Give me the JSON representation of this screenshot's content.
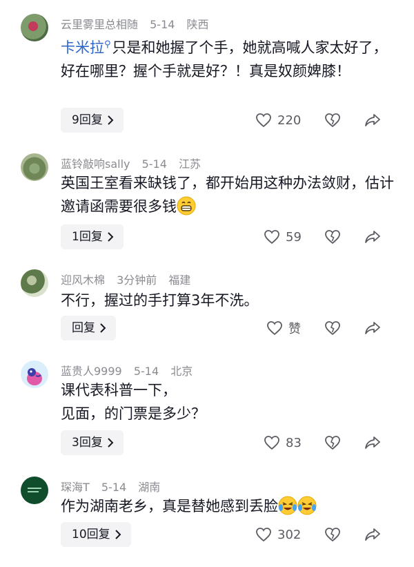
{
  "comments": [
    {
      "username": "云里雾里总相随",
      "date": "5-14",
      "location": "陕西",
      "mention": "卡米拉",
      "text": "只是和她握了个手，她就高喊人家太好了，好在哪里？握个手就是好？！真是奴颜婢膝！",
      "reply_label": "9回复",
      "likes": "220"
    },
    {
      "username": "蓝铃敲响sally",
      "date": "5-14",
      "location": "江苏",
      "text": "英国王室看来缺钱了，都开始用这种办法敛财，估计邀请函需要很多钱",
      "reply_label": "1回复",
      "likes": "59"
    },
    {
      "username": "迎风木棉",
      "date": "3分钟前",
      "location": "福建",
      "text": "不行，握过的手打算3年不洗。",
      "reply_label": "回复",
      "likes": "赞"
    },
    {
      "username": "蓝贵人9999",
      "date": "5-14",
      "location": "北京",
      "text_line1": "课代表科普一下，",
      "text_line2": "见面，的门票是多少？",
      "reply_label": "3回复",
      "likes": "83"
    },
    {
      "username": "琛海T",
      "date": "5-14",
      "location": "湖南",
      "text": "作为湖南老乡，真是替她感到丢脸",
      "reply_label": "10回复",
      "likes": "302"
    }
  ],
  "icons": {
    "like": "heart-outline-icon",
    "dislike": "broken-heart-icon",
    "share": "share-arrow-icon",
    "chevron": "chevron-right-icon",
    "emoji_grin": "grinning-emoji-icon",
    "emoji_cry": "crying-laughing-emoji-icon"
  },
  "colors": {
    "mention": "#2b66c8",
    "meta": "#8a8b91",
    "reply_bg": "#f3f3f5"
  }
}
